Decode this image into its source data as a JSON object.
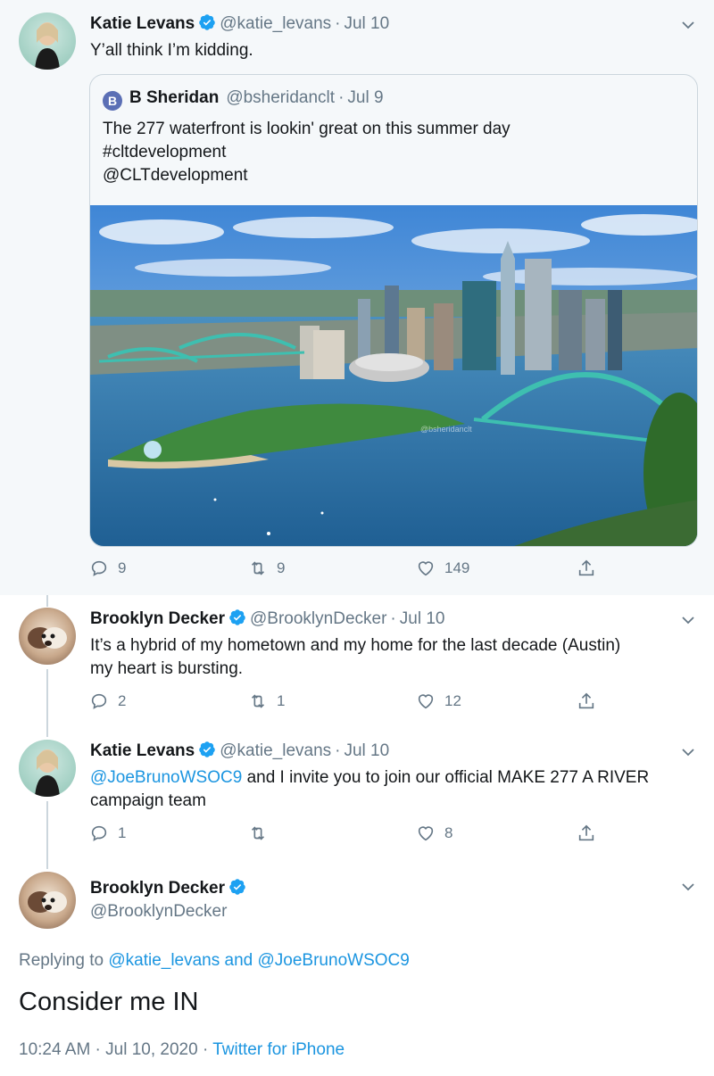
{
  "tweets": [
    {
      "name": "Katie Levans",
      "handle": "@katie_levans",
      "date": "Jul 10",
      "text": "Y’all think I’m kidding.",
      "quote": {
        "avatar_letter": "B",
        "name": "B Sheridan",
        "handle": "@bsheridanclt",
        "date": "Jul 9",
        "lines": [
          "The 277 waterfront is lookin' great on this summer day",
          "#cltdevelopment",
          "@CLTdevelopment"
        ],
        "image_watermark": "@bsheridanclt"
      },
      "replies": "9",
      "retweets": "9",
      "likes": "149"
    },
    {
      "name": "Brooklyn Decker",
      "handle": "@BrooklynDecker",
      "date": "Jul 10",
      "text_line1": "It’s a hybrid of my hometown and my home for the last decade (Austin)",
      "text_line2": "my heart is bursting.",
      "replies": "2",
      "retweets": "1",
      "likes": "12"
    },
    {
      "name": "Katie Levans",
      "handle": "@katie_levans",
      "date": "Jul 10",
      "mention": "@JoeBrunoWSOC9",
      "text_rest": " and I invite you to join our official MAKE 277 A RIVER",
      "text_line2": "campaign team",
      "replies": "1",
      "retweets": "",
      "likes": "8"
    }
  ],
  "main_tweet": {
    "name": "Brooklyn Decker",
    "handle": "@BrooklynDecker",
    "replying_to_prefix": "Replying to ",
    "replying_to_users": "@katie_levans and @JoeBrunoWSOC9",
    "text": "Consider me IN",
    "timestamp": "10:24 AM · Jul 10, 2020 · ",
    "source": "Twitter for iPhone"
  },
  "dot": "·",
  "colors": {
    "link": "#1b95e0",
    "secondary": "#657786",
    "verified": "#1da1f2",
    "thread_line": "#ccd6dd"
  },
  "icons": [
    "verified-badge-icon",
    "chevron-down-icon",
    "reply-icon",
    "retweet-icon",
    "like-icon",
    "share-icon"
  ]
}
